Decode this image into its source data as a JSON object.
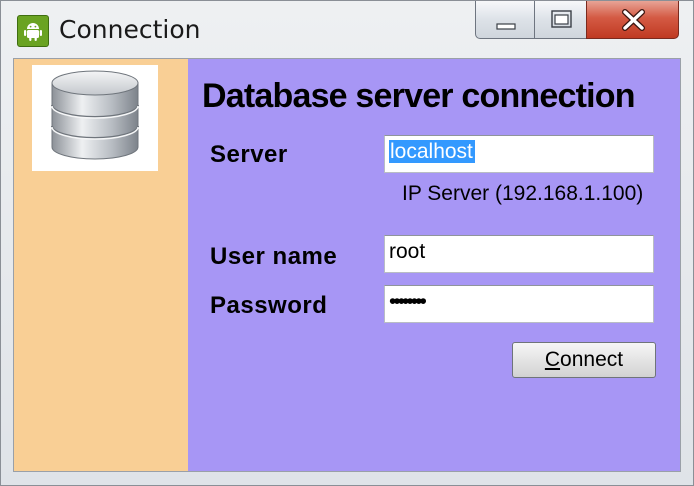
{
  "window": {
    "title": "Connection",
    "app_icon": "android-icon",
    "controls": {
      "minimize_icon": "minimize-icon",
      "maximize_icon": "maximize-icon",
      "close_icon": "close-icon"
    }
  },
  "sidebar": {
    "image_icon": "database-icon",
    "background": "#f9cf95"
  },
  "main": {
    "background": "#a796f5",
    "heading": "Database server connection",
    "server": {
      "label": "Server",
      "value": "localhost",
      "hint": "IP Server (192.168.1.100)"
    },
    "user": {
      "label": "User name",
      "value": "root"
    },
    "password": {
      "label": "Password",
      "value": "••••••••"
    },
    "connect_button": {
      "label": "Connect"
    }
  },
  "colors": {
    "selection": "#3399ff",
    "close_button": "#c9452e"
  }
}
